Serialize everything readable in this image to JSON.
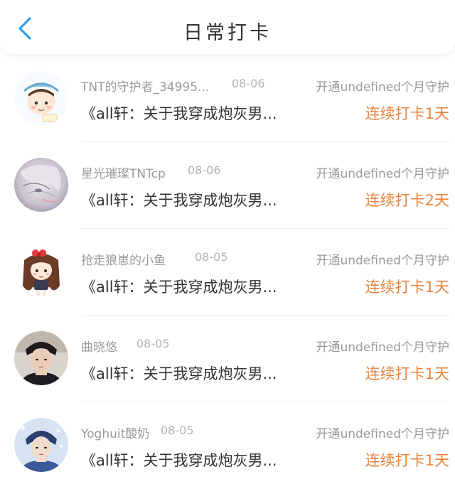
{
  "header": {
    "title": "日常打卡",
    "back_icon": "chevron-left-icon",
    "accent_color": "#2f9bf0"
  },
  "records": [
    {
      "username": "TNT的守护者_34995...",
      "date": "08-06",
      "guard_text": "开通undefined个月守护",
      "book": "《all轩：关于我穿成炮灰男...",
      "streak": "连续打卡1天",
      "avatar": "cartoon-boy-shark-hat-avatar"
    },
    {
      "username": "星光璀璨TNTcp",
      "date": "08-06",
      "guard_text": "开通undefined个月守护",
      "book": "《all轩：关于我穿成炮灰男...",
      "streak": "连续打卡2天",
      "avatar": "anime-drawing-avatar"
    },
    {
      "username": "抢走狼崽的小鱼",
      "date": "08-05",
      "guard_text": "开通undefined个月守护",
      "book": "《all轩：关于我穿成炮灰男...",
      "streak": "连续打卡1天",
      "avatar": "chibi-girl-avatar"
    },
    {
      "username": "曲晓悠",
      "date": "08-05",
      "guard_text": "开通undefined个月守护",
      "book": "《all轩：关于我穿成炮灰男...",
      "streak": "连续打卡1天",
      "avatar": "photo-boy-avatar"
    },
    {
      "username": "Yoghuit酸奶",
      "date": "08-05",
      "guard_text": "开通undefined个月守护",
      "book": "《all轩：关于我穿成炮灰男...",
      "streak": "连续打卡1天",
      "avatar": "photo-boy-blue-avatar"
    }
  ],
  "colors": {
    "streak": "#e8843d",
    "muted_text": "#999999",
    "primary_text": "#333333"
  }
}
